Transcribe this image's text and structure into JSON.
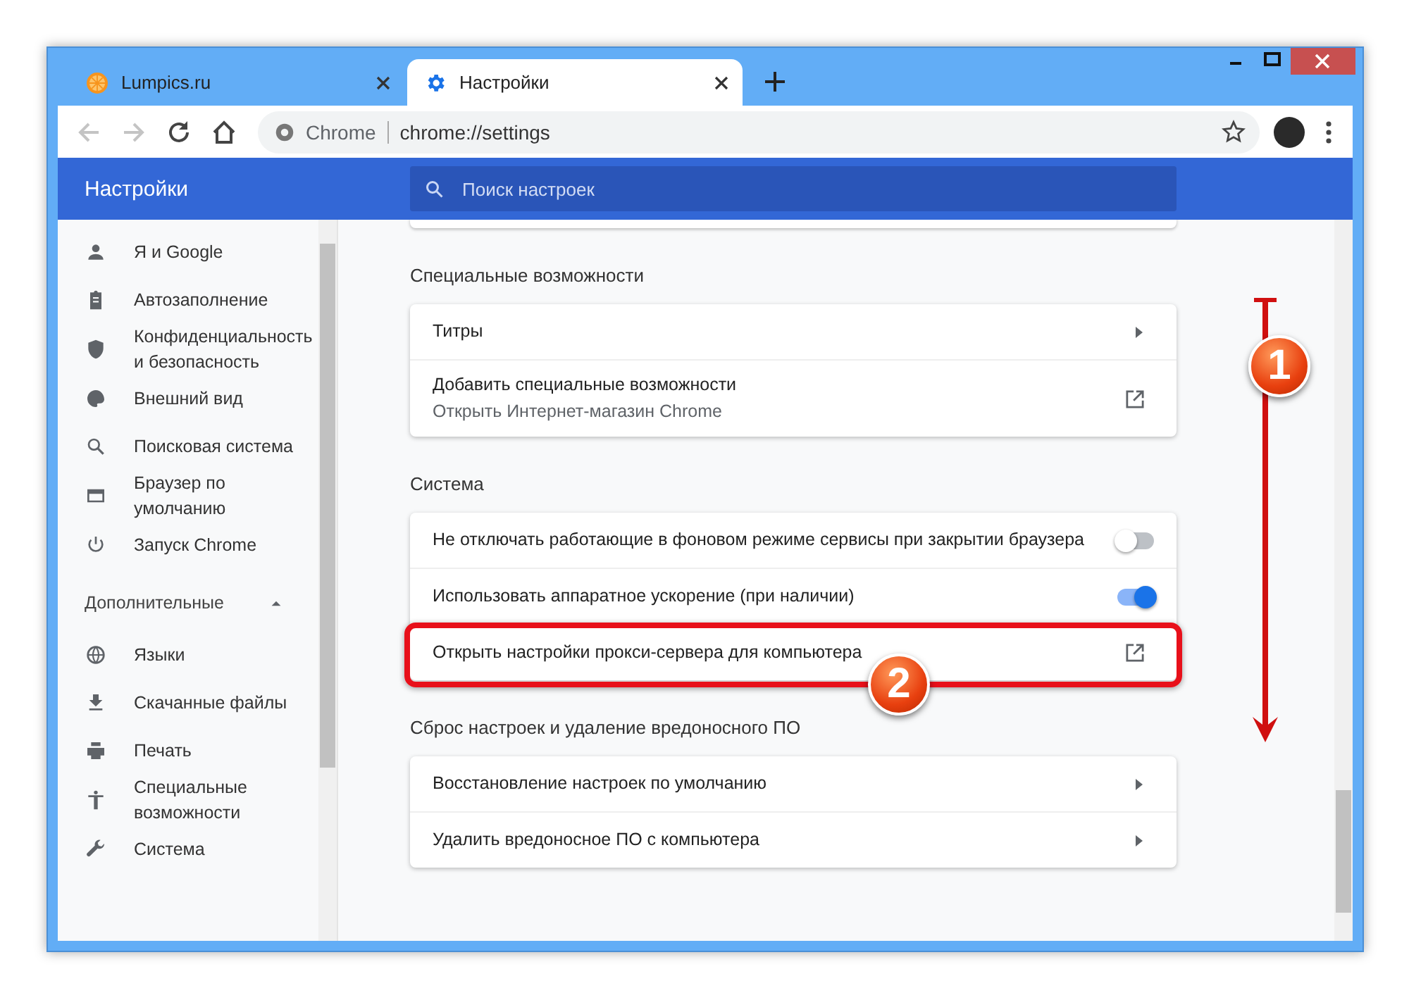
{
  "tabs": [
    {
      "title": "Lumpics.ru",
      "selected": false
    },
    {
      "title": "Настройки",
      "selected": true
    }
  ],
  "address": {
    "site": "Chrome",
    "url": "chrome://settings"
  },
  "header": {
    "title": "Настройки",
    "search_placeholder": "Поиск настроек"
  },
  "sidebar": {
    "items": [
      {
        "label": "Я и Google"
      },
      {
        "label": "Автозаполнение"
      },
      {
        "label": "Конфиденциальность и безопасность"
      },
      {
        "label": "Внешний вид"
      },
      {
        "label": "Поисковая система"
      },
      {
        "label": "Браузер по умолчанию"
      },
      {
        "label": "Запуск Chrome"
      }
    ],
    "advanced": {
      "label": "Дополнительные",
      "expanded": true
    },
    "advanced_items": [
      {
        "label": "Языки"
      },
      {
        "label": "Скачанные файлы"
      },
      {
        "label": "Печать"
      },
      {
        "label": "Специальные возможности"
      },
      {
        "label": "Система"
      }
    ]
  },
  "sections": [
    {
      "title": "Специальные возможности",
      "rows": [
        {
          "kind": "submenu",
          "label": "Титры",
          "highlighted": false
        },
        {
          "kind": "external",
          "label": "Добавить специальные возможности",
          "sublabel": "Открыть Интернет-магазин Chrome",
          "highlighted": false
        }
      ]
    },
    {
      "title": "Система",
      "rows": [
        {
          "kind": "toggle",
          "label": "Не отключать работающие в фоновом режиме сервисы при закрытии браузера",
          "on": false,
          "highlighted": false
        },
        {
          "kind": "toggle",
          "label": "Использовать аппаратное ускорение (при наличии)",
          "on": true,
          "highlighted": false
        },
        {
          "kind": "external",
          "label": "Открыть настройки прокси-сервера для компьютера",
          "highlighted": true
        }
      ]
    },
    {
      "title": "Сброс настроек и удаление вредоносного ПО",
      "rows": [
        {
          "kind": "submenu",
          "label": "Восстановление настроек по умолчанию",
          "highlighted": false
        },
        {
          "kind": "submenu",
          "label": "Удалить вредоносное ПО с компьютера",
          "highlighted": false
        }
      ]
    }
  ],
  "annotations": [
    {
      "label": "1"
    },
    {
      "label": "2"
    }
  ]
}
